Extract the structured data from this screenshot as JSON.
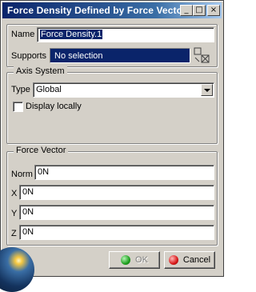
{
  "window": {
    "title": "Force Density Defined by Force Vector",
    "buttons": {
      "minimize": "_",
      "maximize": "□",
      "close": "×"
    }
  },
  "name": {
    "label": "Name",
    "value": "Force Density.1"
  },
  "supports": {
    "label": "Supports",
    "value": "No selection",
    "icon": "supports-selection-icon"
  },
  "axis_system": {
    "title": "Axis System",
    "type_label": "Type",
    "type_value": "Global",
    "display_locally_label": "Display locally",
    "display_locally_checked": false
  },
  "force_vector": {
    "title": "Force Vector",
    "norm_label": "Norm",
    "norm_value": "0N",
    "x_label": "X",
    "x_value": "0N",
    "y_label": "Y",
    "y_value": "0N",
    "z_label": "Z",
    "z_value": "0N"
  },
  "actions": {
    "ok_label": "OK",
    "ok_enabled": false,
    "cancel_label": "Cancel"
  },
  "colors": {
    "title_bar": "#0a246a",
    "selection": "#0a246a",
    "dialog_bg": "#d4d0c8"
  }
}
